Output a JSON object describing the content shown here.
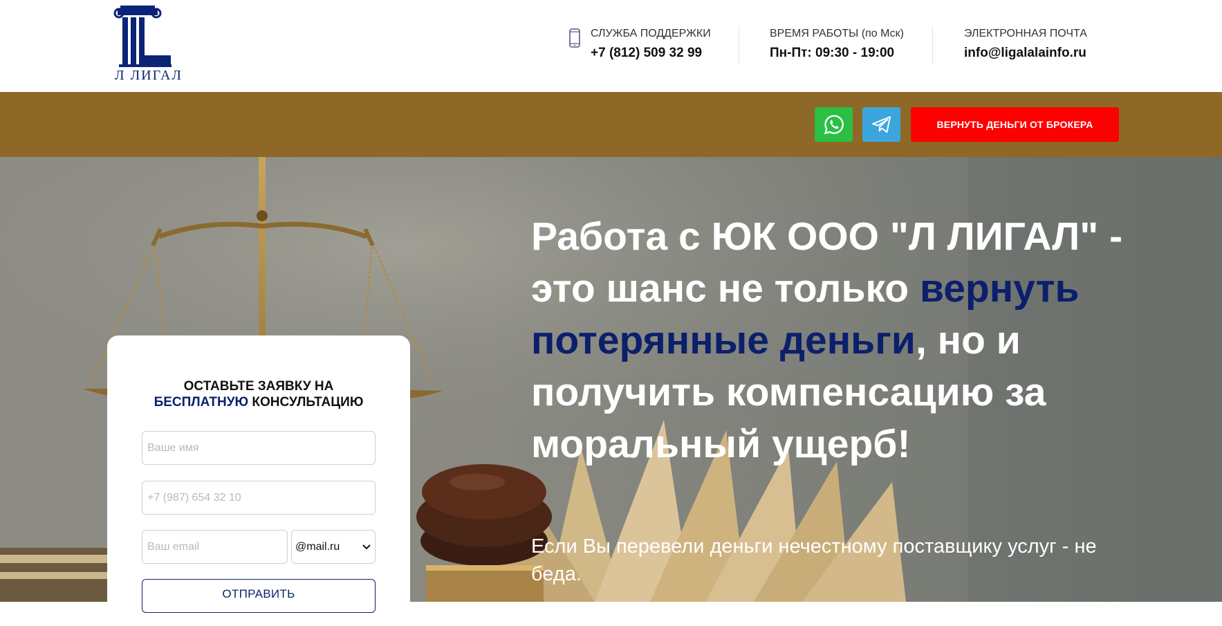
{
  "brand": {
    "logo_text": "Л ЛИГАЛ",
    "color": "#0b2478"
  },
  "contacts": {
    "support": {
      "label": "СЛУЖБА ПОДДЕРЖКИ",
      "value": "+7 (812) 509 32 99",
      "icon": "phone-icon"
    },
    "hours": {
      "label": "ВРЕМЯ РАБОТЫ (по Мск)",
      "value": "Пн-Пт: 09:30 - 19:00"
    },
    "email": {
      "label": "ЭЛЕКТРОННАЯ ПОЧТА",
      "value": "info@ligalalainfo.ru"
    }
  },
  "topbar": {
    "background": "#8d6827",
    "whatsapp_icon": "whatsapp-icon",
    "telegram_icon": "telegram-icon",
    "cta_label": "ВЕРНУТЬ ДЕНЬГИ ОТ БРОКЕРА",
    "cta_color": "#ff0000"
  },
  "hero": {
    "title_part1": "Работа с ЮК ООО \"Л ЛИГАЛ\" - это шанс не только ",
    "title_accent": "вернуть потерянные деньги",
    "title_part2": ", но и получить компенсацию за моральный ущерб!",
    "subtitle": "Если Вы перевели деньги нечестному поставщику услуг - не беда.",
    "accent_color": "#0b1f6b"
  },
  "form": {
    "title_line1": "ОСТАВЬТЕ ЗАЯВКУ НА",
    "title_accent": "БЕСПЛАТНУЮ",
    "title_line2_rest": " КОНСУЛЬТАЦИЮ",
    "name_placeholder": "Ваше имя",
    "phone_placeholder": "+7 (987) 654 32 10",
    "email_placeholder": "Ваш email",
    "domain_selected": "@mail.ru",
    "submit_label": "ОТПРАВИТЬ"
  }
}
